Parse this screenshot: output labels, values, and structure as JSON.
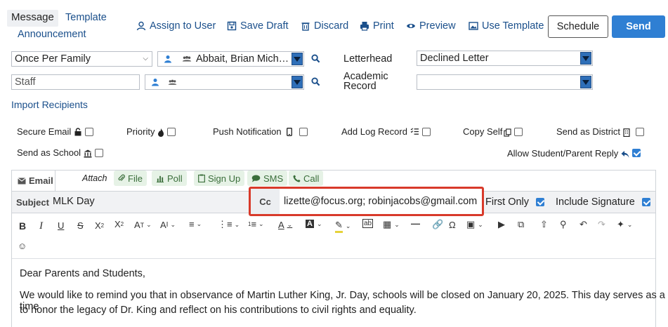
{
  "tabs": {
    "message": "Message",
    "template": "Template",
    "announcement": "Announcement"
  },
  "actions": {
    "assign_user": "Assign to User",
    "save_draft": "Save Draft",
    "discard": "Discard",
    "print": "Print",
    "preview": "Preview",
    "use_template": "Use Template",
    "schedule": "Schedule",
    "send": "Send"
  },
  "filters": {
    "frequency": "Once Per Family",
    "recipient": "Abbait, Brian Mich…",
    "staff_placeholder": "Staff",
    "letterhead_label": "Letterhead",
    "letterhead_value": "Declined Letter",
    "academic_label_1": "Academic",
    "academic_label_2": "Record",
    "academic_value": ""
  },
  "import_recipients": "Import Recipients",
  "options": {
    "secure_email": "Secure Email",
    "priority": "Priority",
    "push_notification": "Push Notification",
    "add_log_record": "Add Log Record",
    "copy_self": "Copy Self",
    "send_as_district": "Send as District",
    "send_as_school": "Send as School",
    "allow_reply": "Allow Student/Parent Reply"
  },
  "editor": {
    "email_tab": "Email",
    "attach_label": "Attach",
    "attach_file": "File",
    "attach_poll": "Poll",
    "attach_signup": "Sign Up",
    "attach_sms": "SMS",
    "attach_call": "Call",
    "subject_label": "Subject",
    "subject_value": "MLK Day",
    "cc_label": "Cc",
    "cc_value": "lizette@focus.org; robinjacobs@gmail.com",
    "first_only": "First Only",
    "include_signature": "Include Signature",
    "greeting": "Dear Parents and Students,",
    "body_line1": "We would like to remind you that in observance of Martin Luther King, Jr. Day, schools will be closed on January 20, 2025. This day serves as a time",
    "body_line2": "to honor the legacy of Dr. King and reflect on his contributions to civil rights and equality."
  },
  "colors": {
    "accent": "#2f7fd3",
    "link": "#1a4f8b",
    "highlight": "#d83a2a",
    "attach_bg": "#e6f2e6"
  }
}
